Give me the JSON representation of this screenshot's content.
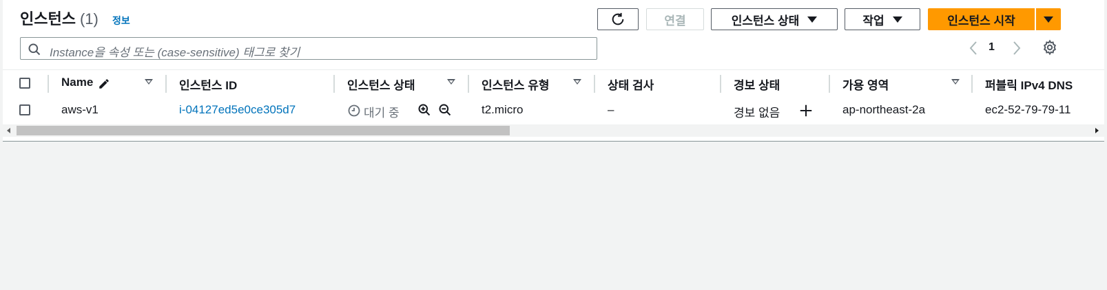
{
  "header": {
    "title": "인스턴스",
    "count": "(1)",
    "info_link": "정보"
  },
  "toolbar": {
    "connect_label": "연결",
    "instance_state_label": "인스턴스 상태",
    "actions_label": "작업",
    "launch_label": "인스턴스 시작"
  },
  "search": {
    "placeholder": "Instance을 속성 또는 (case-sensitive) 태그로 찾기"
  },
  "pagination": {
    "current_page": "1"
  },
  "table": {
    "columns": [
      "Name",
      "인스턴스 ID",
      "인스턴스 상태",
      "인스턴스 유형",
      "상태 검사",
      "경보 상태",
      "가용 영역",
      "퍼블릭 IPv4 DNS"
    ],
    "rows": [
      {
        "name": "aws-v1",
        "instance_id": "i-04127ed5e0ce305d7",
        "state": "대기 중",
        "type": "t2.micro",
        "status_check": "–",
        "alarm_status": "경보 없음",
        "availability_zone": "ap-northeast-2a",
        "public_dns": "ec2-52-79-79-11"
      }
    ]
  },
  "colors": {
    "accent": "#ff9900",
    "link": "#0073bb",
    "background": "#f2f3f3"
  }
}
